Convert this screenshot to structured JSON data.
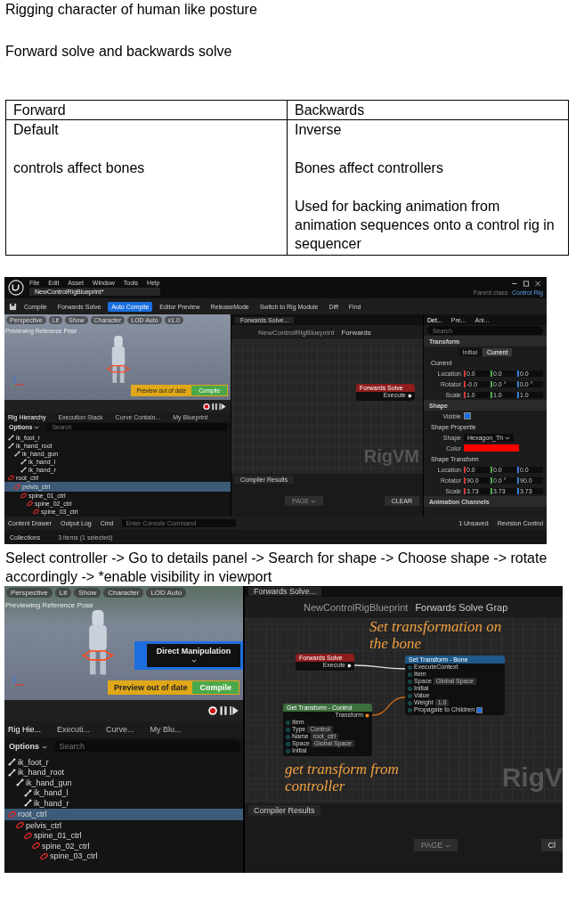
{
  "notes": [
    "Rigging character of human like posture",
    "Forward solve and backwards solve"
  ],
  "table": {
    "columns": [
      "Forward",
      "Backwards"
    ],
    "cells": [
      [
        "Default",
        "controls affect bones"
      ],
      [
        "Inverse",
        "Bones affect controllers",
        "Used for backing animation from animation sequences onto a control rig in sequencer"
      ]
    ]
  },
  "editor_1": {
    "menu": [
      "File",
      "Edit",
      "Asset",
      "Window",
      "Tools",
      "Help"
    ],
    "document_tab": "NewControlRigBlueprint*",
    "parent_class_label": "Parent class:",
    "parent_class": "Control Rig",
    "toolbar": [
      {
        "label": "Compile",
        "active": false
      },
      {
        "label": "Forwards Solve",
        "active": false
      },
      {
        "label": "Auto Compile",
        "active": true
      },
      {
        "label": "Editor Preview",
        "active": false
      },
      {
        "label": "ReleaseMode",
        "active": false
      },
      {
        "label": "Switch to Rig Module",
        "active": false
      },
      {
        "label": "Diff",
        "active": false
      },
      {
        "label": "Find",
        "active": false
      }
    ],
    "viewport": {
      "toolbar": [
        "Perspective",
        "Lit",
        "Show",
        "Character",
        "LOD Auto",
        "x1.0"
      ],
      "caption": "Previewing Reference Pose",
      "banner": "Preview out of date",
      "compile": "Compile"
    },
    "panel_tabs": [
      {
        "label": "Rig Hierarchy",
        "selected": true
      },
      {
        "label": "Execution Stack",
        "selected": false
      },
      {
        "label": "Curve Contain...",
        "selected": false
      },
      {
        "label": "My Blueprint",
        "selected": false
      }
    ],
    "options": "Options",
    "search_placeholder": "Search",
    "tree": [
      {
        "label": "ik_foot_r",
        "kind": "bone",
        "selected": false
      },
      {
        "label": "ik_hand_root",
        "kind": "bone",
        "selected": false,
        "children": [
          {
            "label": "ik_hand_gun",
            "kind": "bone",
            "selected": false,
            "children": [
              {
                "label": "ik_hand_l",
                "kind": "bone",
                "selected": false
              },
              {
                "label": "ik_hand_r",
                "kind": "bone",
                "selected": false
              }
            ]
          }
        ]
      },
      {
        "label": "root_ctrl",
        "kind": "control",
        "selected": false,
        "children": [
          {
            "label": "pelvis_ctrl",
            "kind": "control",
            "selected": true,
            "children": [
              {
                "label": "spine_01_ctrl",
                "kind": "control",
                "selected": false,
                "children": [
                  {
                    "label": "spine_02_ctrl",
                    "kind": "control",
                    "selected": false,
                    "children": [
                      {
                        "label": "spine_03_ctrl",
                        "kind": "control",
                        "selected": false
                      }
                    ]
                  }
                ]
              }
            ]
          }
        ]
      }
    ],
    "graph": {
      "tab": "Forwards Solve...",
      "path": [
        "NewControlRigBlueprint",
        "Forwards"
      ],
      "nodes": [
        {
          "kind": "event",
          "title": "Forwards Solve",
          "pins": [
            {
              "label": "Execute"
            }
          ]
        }
      ],
      "watermark": "RigVM",
      "compiler_tab": "Compiler Results",
      "page": "PAGE",
      "clear": "CLEAR"
    },
    "details": {
      "tabs": [
        {
          "label": "Det...",
          "selected": true
        },
        {
          "label": "Pre...",
          "selected": false
        },
        {
          "label": "Ani...",
          "selected": false
        }
      ],
      "search_placeholder": "Search",
      "rows": [
        {
          "kind": "section",
          "label": "Transform"
        },
        {
          "kind": "toggle",
          "options": [
            {
              "label": "Initial",
              "selected": false
            },
            {
              "label": "Current",
              "selected": true
            }
          ]
        },
        {
          "kind": "subsection",
          "label": "Current"
        },
        {
          "kind": "vector",
          "label": "Location",
          "values": [
            "0.0",
            "0.0",
            "0.0"
          ]
        },
        {
          "kind": "vector",
          "label": "Rotator",
          "values": [
            "-0.0",
            "0.0 °",
            "0.0 °"
          ]
        },
        {
          "kind": "vector",
          "label": "Scale",
          "values": [
            "1.0",
            "1.0",
            "1.0"
          ]
        },
        {
          "kind": "section",
          "label": "Shape"
        },
        {
          "kind": "check",
          "label": "Visible",
          "checked": true
        },
        {
          "kind": "subsection",
          "label": "Shape Propertie"
        },
        {
          "kind": "select",
          "label": "Shape",
          "value": "Hexagon_Th"
        },
        {
          "kind": "color",
          "label": "Color",
          "color": "#ff0000"
        },
        {
          "kind": "subsection",
          "label": "Shape Transform"
        },
        {
          "kind": "vector",
          "label": "Location",
          "values": [
            "0.0",
            "0.0",
            "0.0"
          ]
        },
        {
          "kind": "vector",
          "label": "Rotator",
          "values": [
            "90.0",
            "0.0 °",
            "90.0"
          ]
        },
        {
          "kind": "vector",
          "label": "Scale",
          "values": [
            "3.73",
            "3.73",
            "3.73"
          ]
        },
        {
          "kind": "section",
          "label": "Animation Channels"
        }
      ]
    },
    "status": {
      "items": [
        "Content Drawer",
        "Output Log",
        "Cmd"
      ],
      "console_placeholder": "Enter Console Command",
      "unsaved": "1 Unsaved",
      "revision": "Revision Control",
      "collections": "Collections",
      "selection": "3 items (1 selected)"
    }
  },
  "caption": "Select controller -> Go to details panel -> Search for shape -> Choose shape -> rotate accordingly -> *enable visibility in viewport",
  "editor_2": {
    "viewport": {
      "toolbar": [
        "Perspective",
        "Lit",
        "Show",
        "Character",
        "LOD Auto"
      ],
      "caption": "Previewing Reference Pose",
      "mode": "Direct Manipulation",
      "banner": "Preview out of date",
      "compile": "Compile"
    },
    "panel_tabs": [
      {
        "label": "Rig Hie...",
        "selected": true
      },
      {
        "label": "Executi...",
        "selected": false
      },
      {
        "label": "Curve...",
        "selected": false
      },
      {
        "label": "My Blu...",
        "selected": false
      }
    ],
    "options": "Options",
    "search_placeholder": "Search",
    "tree": [
      {
        "label": "ik_foot_r",
        "kind": "bone",
        "selected": false
      },
      {
        "label": "ik_hand_root",
        "kind": "bone",
        "selected": false,
        "children": [
          {
            "label": "ik_hand_gun",
            "kind": "bone",
            "selected": false,
            "children": [
              {
                "label": "ik_hand_l",
                "kind": "bone",
                "selected": false
              },
              {
                "label": "ik_hand_r",
                "kind": "bone",
                "selected": false
              }
            ]
          }
        ]
      },
      {
        "label": "root_ctrl",
        "kind": "control",
        "selected": true,
        "children": [
          {
            "label": "pelvis_ctrl",
            "kind": "control",
            "selected": false,
            "children": [
              {
                "label": "spine_01_ctrl",
                "kind": "control",
                "selected": false,
                "children": [
                  {
                    "label": "spine_02_ctrl",
                    "kind": "control",
                    "selected": false,
                    "children": [
                      {
                        "label": "spine_03_ctrl",
                        "kind": "control",
                        "selected": false
                      }
                    ]
                  }
                ]
              }
            ]
          }
        ]
      }
    ],
    "graph": {
      "tab": "Forwards Solve...",
      "path": [
        "NewControlRigBlueprint",
        "Forwards Solve Grap"
      ],
      "nodes": [
        {
          "kind": "event",
          "title": "Forwards Solve",
          "pins": [
            {
              "label": "Execute"
            }
          ]
        },
        {
          "kind": "function",
          "title": "Set Transform - Bone",
          "pins": [
            {
              "label": "ExecuteContext"
            },
            {
              "label": "Item"
            },
            {
              "label": "Space",
              "value": "Global Space"
            },
            {
              "label": "Initial"
            },
            {
              "label": "Value"
            },
            {
              "label": "Weight",
              "value": "1.0"
            },
            {
              "label": "Propagate to Children",
              "checked": true
            }
          ]
        },
        {
          "kind": "getter",
          "title": "Get Transform - Control",
          "output": "Transform",
          "pins": [
            {
              "label": "Item"
            },
            {
              "label": "Type",
              "value": "Control"
            },
            {
              "label": "Name",
              "value": "root_ctrl"
            },
            {
              "label": "Space",
              "value": "Global Space"
            },
            {
              "label": "Initial"
            }
          ]
        }
      ],
      "annotations": [
        "Set transformation on the bone",
        "get transform from controller"
      ],
      "watermark": "RigV",
      "compiler_tab": "Compiler Results",
      "page": "PAGE",
      "clear": "Cl"
    }
  }
}
